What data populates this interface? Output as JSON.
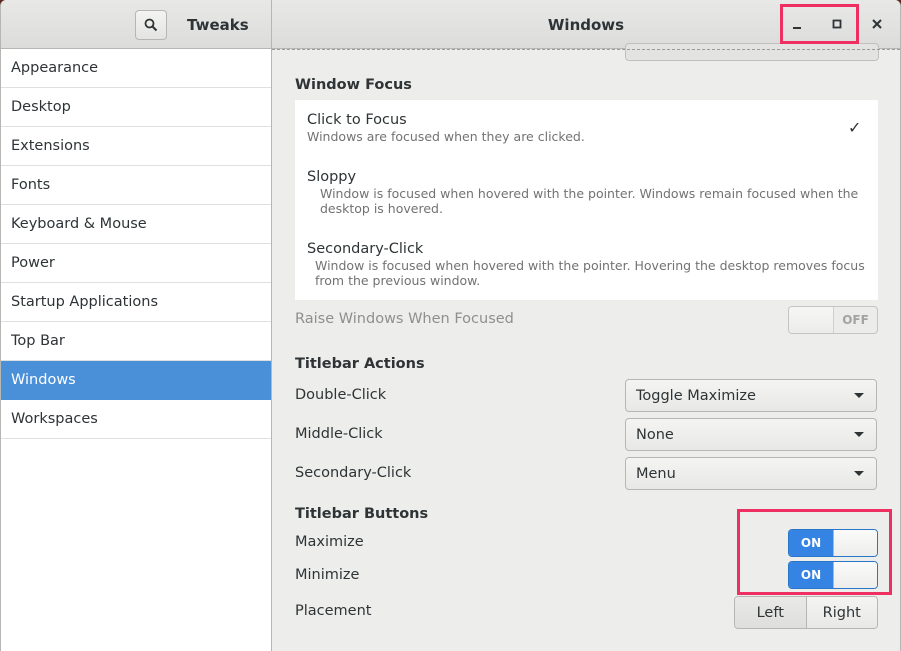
{
  "sidebar_title": "Tweaks",
  "window_title": "Windows",
  "colors": {
    "accent": "#4a90d9",
    "highlight": "#ed2f62",
    "switch_on": "#3584e4"
  },
  "sidebar": {
    "items": [
      {
        "label": "Appearance"
      },
      {
        "label": "Desktop"
      },
      {
        "label": "Extensions"
      },
      {
        "label": "Fonts"
      },
      {
        "label": "Keyboard & Mouse"
      },
      {
        "label": "Power"
      },
      {
        "label": "Startup Applications"
      },
      {
        "label": "Top Bar"
      },
      {
        "label": "Windows",
        "active": true
      },
      {
        "label": "Workspaces"
      }
    ]
  },
  "window_focus": {
    "heading": "Window Focus",
    "options": [
      {
        "title": "Click to Focus",
        "desc": "Windows are focused when they are clicked.",
        "selected": true
      },
      {
        "title": "Sloppy",
        "desc": "Window is focused when hovered with the pointer. Windows remain focused when the desktop is hovered."
      },
      {
        "title": "Secondary-Click",
        "desc": "Window is focused when hovered with the pointer. Hovering the desktop removes focus from the previous window."
      }
    ],
    "checkmark": "✓"
  },
  "raise_windows": {
    "label": "Raise Windows When Focused",
    "state": "OFF"
  },
  "titlebar_actions": {
    "heading": "Titlebar Actions",
    "rows": [
      {
        "label": "Double-Click",
        "value": "Toggle Maximize"
      },
      {
        "label": "Middle-Click",
        "value": "None"
      },
      {
        "label": "Secondary-Click",
        "value": "Menu"
      }
    ]
  },
  "titlebar_buttons": {
    "heading": "Titlebar Buttons",
    "maximize": {
      "label": "Maximize",
      "state": "ON"
    },
    "minimize": {
      "label": "Minimize",
      "state": "ON"
    },
    "placement": {
      "label": "Placement",
      "left": "Left",
      "right": "Right"
    }
  },
  "icons": {
    "search": "search-icon",
    "minimize": "minimize-icon",
    "maximize": "maximize-icon",
    "close": "close-icon",
    "dropdown": "chevron-down-icon"
  }
}
